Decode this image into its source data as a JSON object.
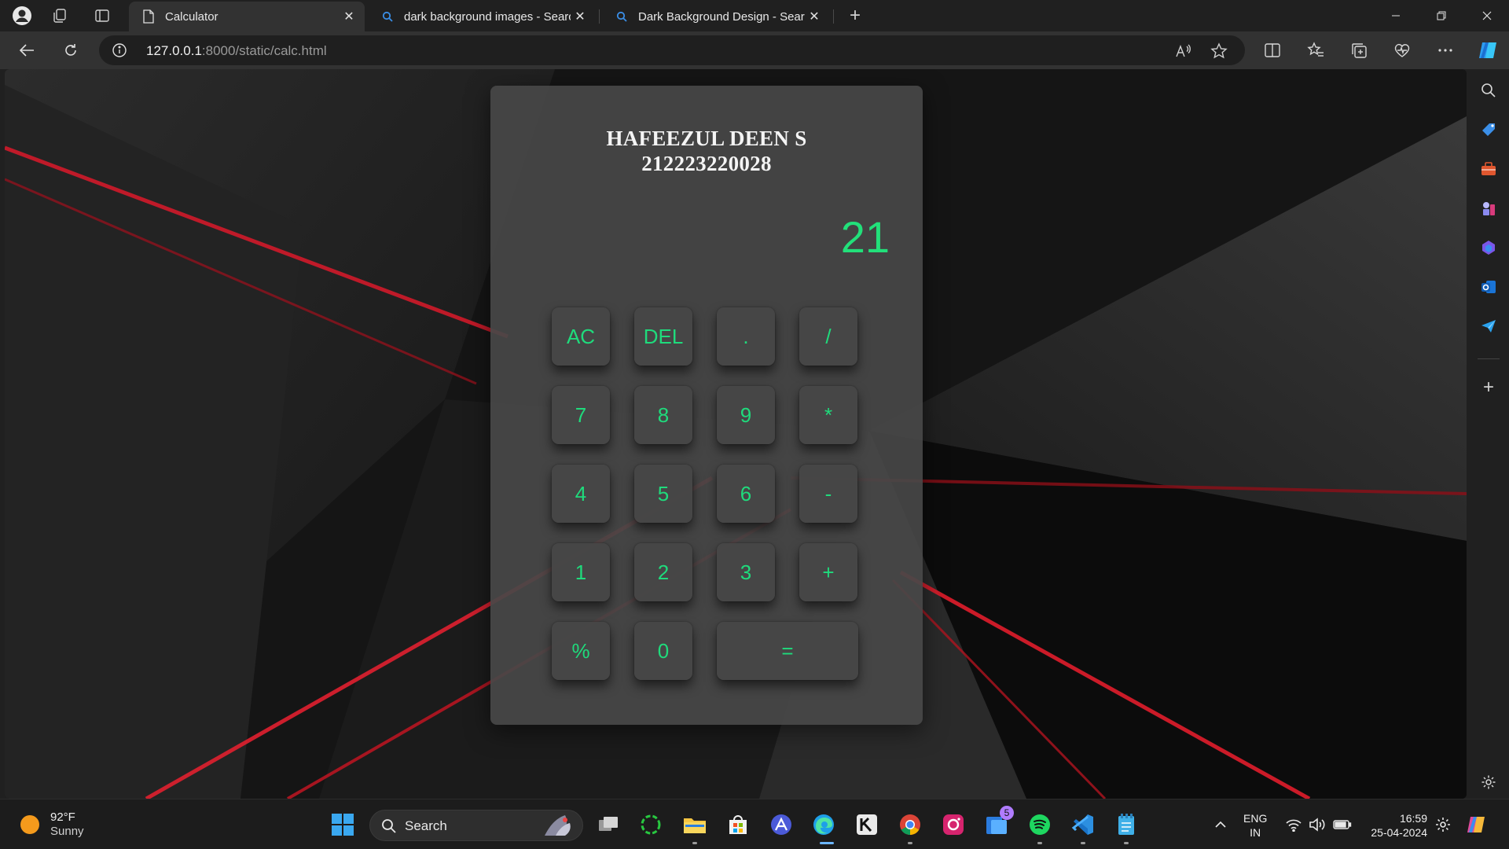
{
  "browser": {
    "tabs": [
      {
        "title": "Calculator",
        "active": true
      },
      {
        "title": "dark background images - Search",
        "active": false
      },
      {
        "title": "Dark Background Design - Search",
        "active": false
      }
    ],
    "address": {
      "host": "127.0.0.1",
      "path": ":8000/static/calc.html"
    }
  },
  "calculator": {
    "name": "HAFEEZUL DEEN S",
    "id": "212223220028",
    "display": "21",
    "keys": {
      "ac": "AC",
      "del": "DEL",
      "dot": ".",
      "divide": "/",
      "seven": "7",
      "eight": "8",
      "nine": "9",
      "multiply": "*",
      "four": "4",
      "five": "5",
      "six": "6",
      "minus": "-",
      "one": "1",
      "two": "2",
      "three": "3",
      "plus": "+",
      "percent": "%",
      "zero": "0",
      "equals": "="
    },
    "accent_color": "#1fdb7c"
  },
  "taskbar": {
    "weather": {
      "temp": "92°F",
      "condition": "Sunny"
    },
    "search_label": "Search",
    "lang": {
      "line1": "ENG",
      "line2": "IN"
    },
    "clock": {
      "time": "16:59",
      "date": "25-04-2024"
    },
    "badge_count": "5"
  }
}
